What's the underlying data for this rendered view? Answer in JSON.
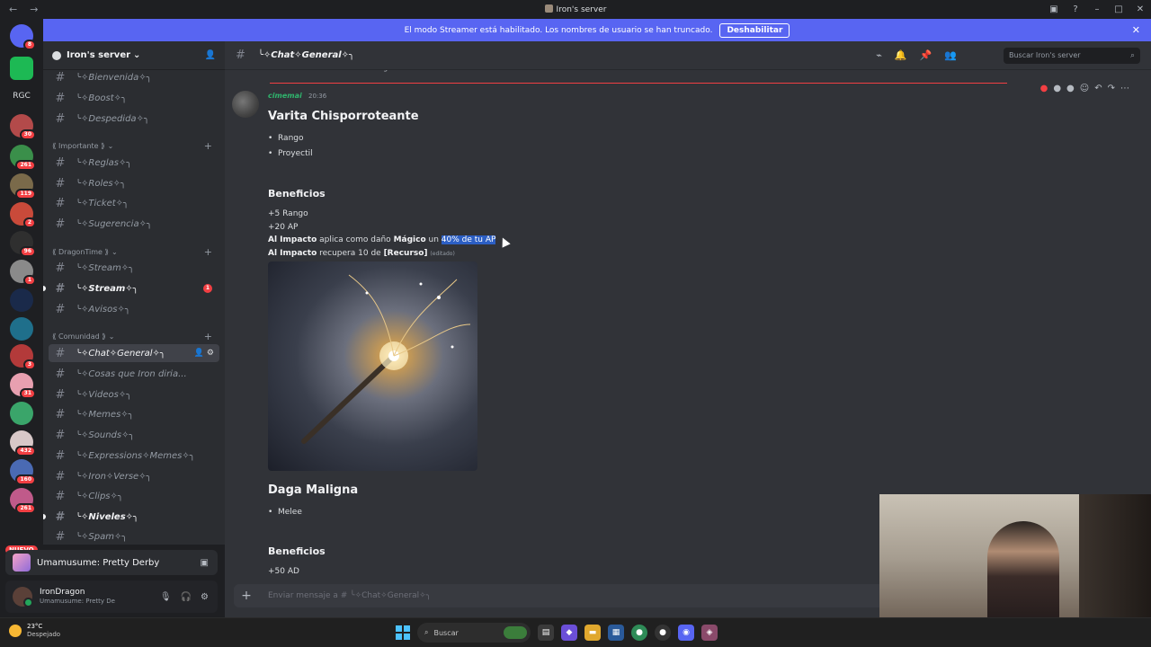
{
  "window": {
    "title": "Iron's server"
  },
  "banner": {
    "text": "El modo Streamer está habilitado. Los nombres de usuario se han truncado.",
    "button": "Deshabilitar"
  },
  "rail": {
    "top_label": "RGC",
    "badges": [
      "8",
      "30",
      "261",
      "119",
      "2",
      "96",
      "1",
      "3",
      "31",
      "160",
      "432",
      "2",
      "261"
    ],
    "new_label": "NUEVO"
  },
  "server": {
    "name": "Iron's server"
  },
  "channels": [
    {
      "name": "╰✧Bienvenida✧╮"
    },
    {
      "name": "╰✧Boost✧╮"
    },
    {
      "name": "╰✧Despedida✧╮"
    },
    {
      "name": "╰✧Reglas✧╮"
    },
    {
      "name": "╰✧Roles✧╮"
    },
    {
      "name": "╰✧Ticket✧╮"
    },
    {
      "name": "╰✧Sugerencia✧╮"
    },
    {
      "name": "╰✧Stream✧╮"
    },
    {
      "name": "╰✧Stream✧╮",
      "badge": "1"
    },
    {
      "name": "╰✧Avisos✧╮"
    },
    {
      "name": "╰✧Chat✧General✧╮"
    },
    {
      "name": "╰✧Cosas que Iron diria..."
    },
    {
      "name": "╰✧Videos✧╮"
    },
    {
      "name": "╰✧Memes✧╮"
    },
    {
      "name": "╰✧Sounds✧╮"
    },
    {
      "name": "╰✧Expressions✧Memes✧╮"
    },
    {
      "name": "╰✧Iron✧Verse✧╮"
    },
    {
      "name": "╰✧Clips✧╮"
    },
    {
      "name": "╰✧Niveles✧╮"
    },
    {
      "name": "╰✧Spam✧╮"
    }
  ],
  "categories": [
    "⟪ Importante ⟫",
    "⟪ DragonTime ⟫",
    "⟪ Comunidad ⟫"
  ],
  "activity": {
    "game": "Umamusume: Pretty Derby"
  },
  "user": {
    "name": "IronDragon",
    "status": "Umamusume: Pretty De"
  },
  "chat": {
    "channel": "╰✧Chat✧General✧╮",
    "search_placeholder": "Buscar Iron's server",
    "previous_line": "todos los obesos mórbidos son iguales u.u",
    "author": "cimemai",
    "time": "20:36",
    "messages": {
      "title1": "Varita Chisporroteante",
      "bullets1": [
        "Rango",
        "Proyectil"
      ],
      "benefits": "Beneficios",
      "line1": "+5 Rango",
      "line2": "+20 AP",
      "l3a": "Al Impacto",
      "l3b": " aplica como daño ",
      "l3c": "Mágico",
      "l3d": " un ",
      "l3e": "40% de tu AP",
      "l4a": "Al Impacto",
      "l4b": " recupera 10 de ",
      "l4c": "[Recurso]",
      "edited": "(editado)",
      "title2": "Daga Maligna",
      "bullets2": [
        "Melee"
      ],
      "benefits2": "Beneficios",
      "line5": "+50 AD"
    },
    "composer_placeholder": "Enviar mensaje a # ╰✧Chat✧General✧╮"
  },
  "taskbar": {
    "temp": "23°C",
    "weather": "Despejado",
    "search": "Buscar"
  }
}
